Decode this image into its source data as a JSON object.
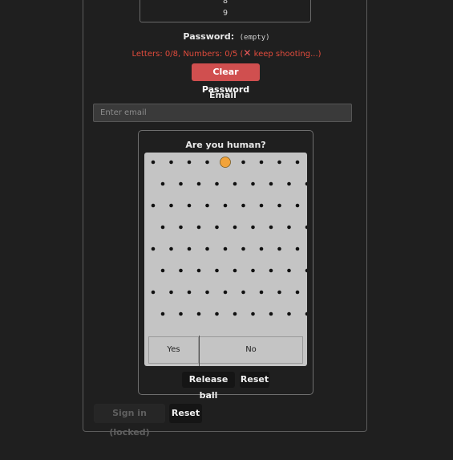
{
  "scroll_list": {
    "numbers": [
      "8",
      "9"
    ]
  },
  "password": {
    "label": "Password:",
    "value": "(empty)"
  },
  "warning": {
    "text_before": "Letters: 0/8, Numbers: 0/5 (",
    "icon": "cross-mark-icon",
    "icon_glyph": "✕",
    "text_after": " keep shooting...)"
  },
  "clear_password_label": "Clear Password",
  "email": {
    "label": "Email",
    "placeholder": "Enter email"
  },
  "captcha": {
    "title": "Are you human?",
    "bins": {
      "yes": "Yes",
      "no": "No"
    },
    "ball_color": "#f2a33a",
    "release_label": "Release ball",
    "reset_label": "Reset"
  },
  "actions": {
    "signin_label": "Sign in (locked)",
    "reset_label": "Reset"
  },
  "colors": {
    "accent_red": "#d04f4f",
    "warning_text": "#e04b3c"
  }
}
